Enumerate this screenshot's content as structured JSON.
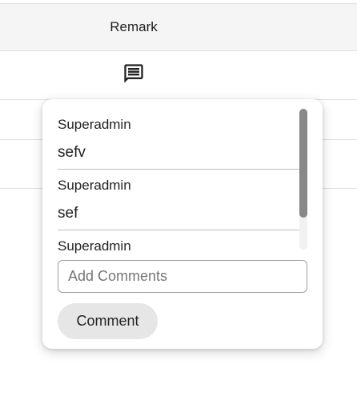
{
  "table": {
    "header": {
      "remark": "Remark"
    },
    "rows": [
      {
        "remark_icon": "comment-icon"
      },
      {
        "remark_icon": ""
      },
      {
        "remark_icon": ""
      }
    ]
  },
  "popover": {
    "comments": [
      {
        "author": "Superadmin",
        "text": "sefv"
      },
      {
        "author": "Superadmin",
        "text": "sef"
      },
      {
        "author": "Superadmin",
        "text": ""
      }
    ],
    "input": {
      "placeholder": "Add Comments",
      "value": ""
    },
    "submit_label": "Comment"
  },
  "colors": {
    "header_bg": "#f5f5f5",
    "divider": "#e0e0e0",
    "button_bg": "#e6e6e6",
    "scrollbar_thumb": "#888888"
  }
}
